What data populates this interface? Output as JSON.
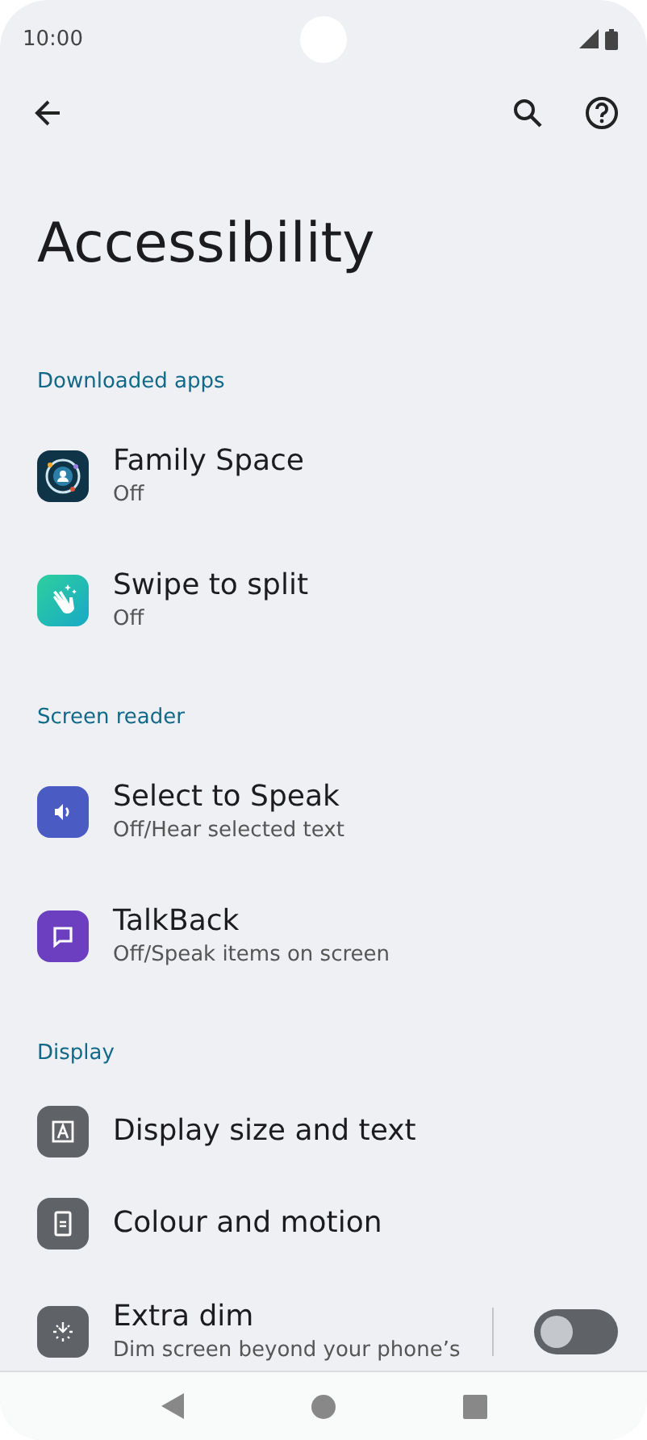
{
  "status_bar": {
    "time": "10:00"
  },
  "title": "Accessibility",
  "sections": [
    {
      "header": "Downloaded apps",
      "items": [
        {
          "kind": "link",
          "title": "Family Space",
          "subtitle": "Off"
        },
        {
          "kind": "link",
          "title": "Swipe to split",
          "subtitle": "Off"
        }
      ]
    },
    {
      "header": "Screen reader",
      "items": [
        {
          "kind": "link",
          "title": "Select to Speak",
          "subtitle": "Off/Hear selected text"
        },
        {
          "kind": "link",
          "title": "TalkBack",
          "subtitle": "Off/Speak items on screen"
        }
      ]
    },
    {
      "header": "Display",
      "items": [
        {
          "kind": "link",
          "title": "Display size and text"
        },
        {
          "kind": "link",
          "title": "Colour and motion"
        },
        {
          "kind": "switch",
          "title": "Extra dim",
          "subtitle": "Dim screen beyond your phone’s",
          "on": false
        }
      ]
    }
  ]
}
